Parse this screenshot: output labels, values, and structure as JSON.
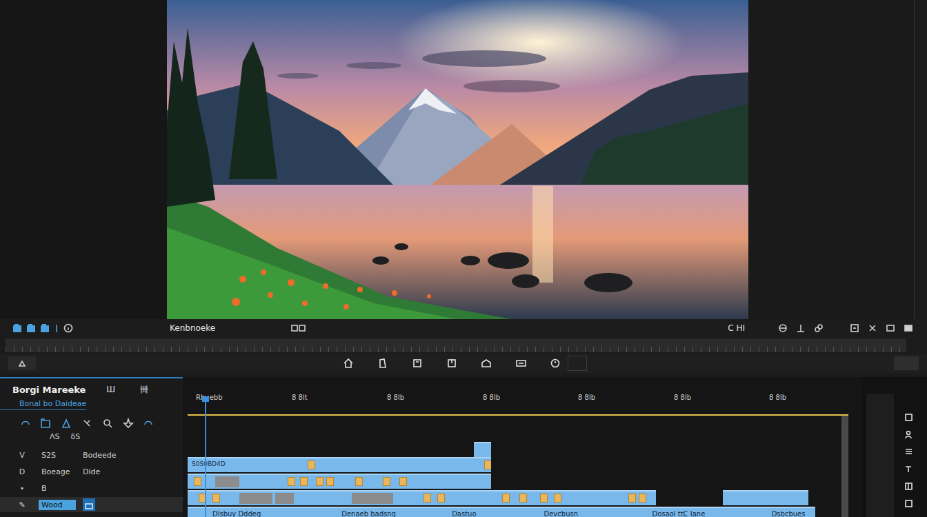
{
  "toolbar": {
    "title": "Kenbnoeke",
    "timecode": "C HI"
  },
  "panel": {
    "title": "Borgi Mareeke",
    "title_icons": [
      "Ш",
      "卌"
    ],
    "subtitle": "Bonal bo Daideae",
    "tool_labels": [
      "ΛS",
      "δS"
    ],
    "tracks": [
      {
        "toggle": "V",
        "name": "S2S",
        "extra": "Bodeede",
        "selected": false
      },
      {
        "toggle": "D",
        "name": "Boeage",
        "extra": "Dide",
        "selected": false
      },
      {
        "toggle": "•",
        "name": "B",
        "extra": "",
        "selected": false
      },
      {
        "toggle": "✎",
        "name": "Wood",
        "extra": "",
        "selected": true
      }
    ]
  },
  "timeline": {
    "ruler": [
      "Rbuebb",
      "8 8lt",
      "8 8lb",
      "8 8lb",
      "8 8lb",
      "8 8lb",
      "8 8lb"
    ],
    "playhead": 0.026,
    "overlay": [
      {
        "start": 0.439,
        "end": 0.465
      }
    ],
    "tracks": [
      {
        "clips": [
          {
            "start": 0,
            "end": 0.465,
            "label": "S0S0BD4D",
            "segments": [],
            "markers": [
              0.184,
              0.455
            ],
            "labels": []
          }
        ]
      },
      {
        "clips": [
          {
            "start": 0,
            "end": 0.465,
            "label": "",
            "segments": [
              [
                0.042,
                0.079
              ]
            ],
            "markers": [
              0.01,
              0.153,
              0.172,
              0.197,
              0.213,
              0.257,
              0.299,
              0.325
            ],
            "labels": []
          }
        ]
      },
      {
        "clips": [
          {
            "start": 0,
            "end": 0.718,
            "label": "",
            "segments": [
              [
                0.079,
                0.13
              ],
              [
                0.134,
                0.163
              ],
              [
                0.252,
                0.315
              ]
            ],
            "markers": [
              0.017,
              0.038,
              0.362,
              0.383,
              0.482,
              0.508,
              0.54,
              0.561,
              0.676,
              0.691
            ],
            "labels": []
          },
          {
            "start": 0.82,
            "end": 0.951,
            "label": "",
            "segments": [],
            "markers": [],
            "labels": []
          }
        ]
      },
      {
        "clips": [
          {
            "start": 0,
            "end": 0.962,
            "label": "",
            "segments": [],
            "markers": [],
            "labels": [
              {
                "text": "Dlsbuy Dddeg",
                "at": 0.038
              },
              {
                "text": "Denaeb badsng",
                "at": 0.236
              },
              {
                "text": "Dastuo",
                "at": 0.405
              },
              {
                "text": "Devcbusn",
                "at": 0.546
              },
              {
                "text": "Dosaol ttC Iane",
                "at": 0.712
              },
              {
                "text": "Dsbcbues",
                "at": 0.895
              }
            ]
          }
        ]
      }
    ]
  }
}
